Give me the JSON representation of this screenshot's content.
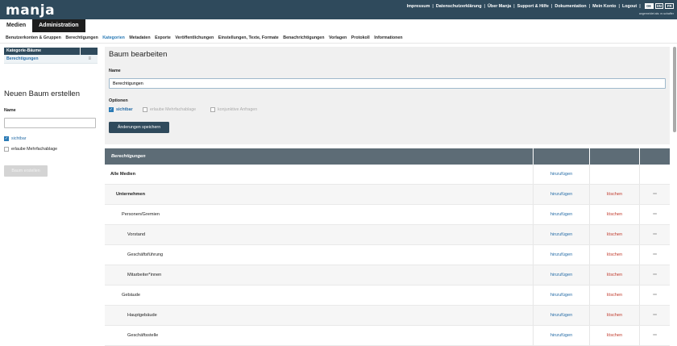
{
  "topbar": {
    "logo": "manja",
    "links": [
      "Impressum",
      "Datenschutzerklärung",
      "Über Manja",
      "Support & Hilfe",
      "Dokumentation",
      "Mein Konto",
      "Logout"
    ],
    "languages": [
      "DE",
      "EN",
      "FR"
    ],
    "user_line": "angemeldet als: m.schaffer"
  },
  "main_tabs": [
    "Medien",
    "Administration"
  ],
  "subnav": [
    "Benutzerkonten & Gruppen",
    "Berechtigungen",
    "Kategorien",
    "Metadaten",
    "Exporte",
    "Veröffentlichungen",
    "Einstellungen, Texte, Formate",
    "Benachrichtigungen",
    "Vorlagen",
    "Protokoll",
    "Informationen"
  ],
  "left": {
    "trees_header": "Kategorie-Bäume",
    "trees": [
      "Berechtigungen"
    ],
    "new_tree_title": "Neuen Baum erstellen",
    "name_label": "Name",
    "name_value": "",
    "opt_visible": "sichtbar",
    "opt_multi": "erlaube Mehrfachablage",
    "create_button": "Baum erstellen"
  },
  "edit": {
    "title": "Baum bearbeiten",
    "name_label": "Name",
    "name_value": "Berechtigungen",
    "options_label": "Optionen",
    "opt_visible": "sichtbar",
    "opt_multi": "erlaube Mehrfachablage",
    "opt_conj": "konjunktive Anfragen",
    "save_button": "Änderungen speichern"
  },
  "table": {
    "header": "Berechtigungen",
    "rows": [
      {
        "label": "Alle Medien",
        "add": "hinzufügen",
        "del": "",
        "bold": true,
        "indent": 0
      },
      {
        "label": "Unternehmen",
        "add": "hinzufügen",
        "del": "löschen",
        "bold": true,
        "indent": 1
      },
      {
        "label": "Personen/Gremien",
        "add": "hinzufügen",
        "del": "löschen",
        "bold": false,
        "indent": 2
      },
      {
        "label": "Vorstand",
        "add": "hinzufügen",
        "del": "löschen",
        "bold": false,
        "indent": 3
      },
      {
        "label": "Geschäftsführung",
        "add": "hinzufügen",
        "del": "löschen",
        "bold": false,
        "indent": 3
      },
      {
        "label": "Mitarbeiter*innen",
        "add": "hinzufügen",
        "del": "löschen",
        "bold": false,
        "indent": 3
      },
      {
        "label": "Gebäude",
        "add": "hinzufügen",
        "del": "löschen",
        "bold": false,
        "indent": 2
      },
      {
        "label": "Hauptgebäude",
        "add": "hinzufügen",
        "del": "löschen",
        "bold": false,
        "indent": 3
      },
      {
        "label": "Geschäftsstelle",
        "add": "hinzufügen",
        "del": "löschen",
        "bold": false,
        "indent": 3
      }
    ]
  }
}
